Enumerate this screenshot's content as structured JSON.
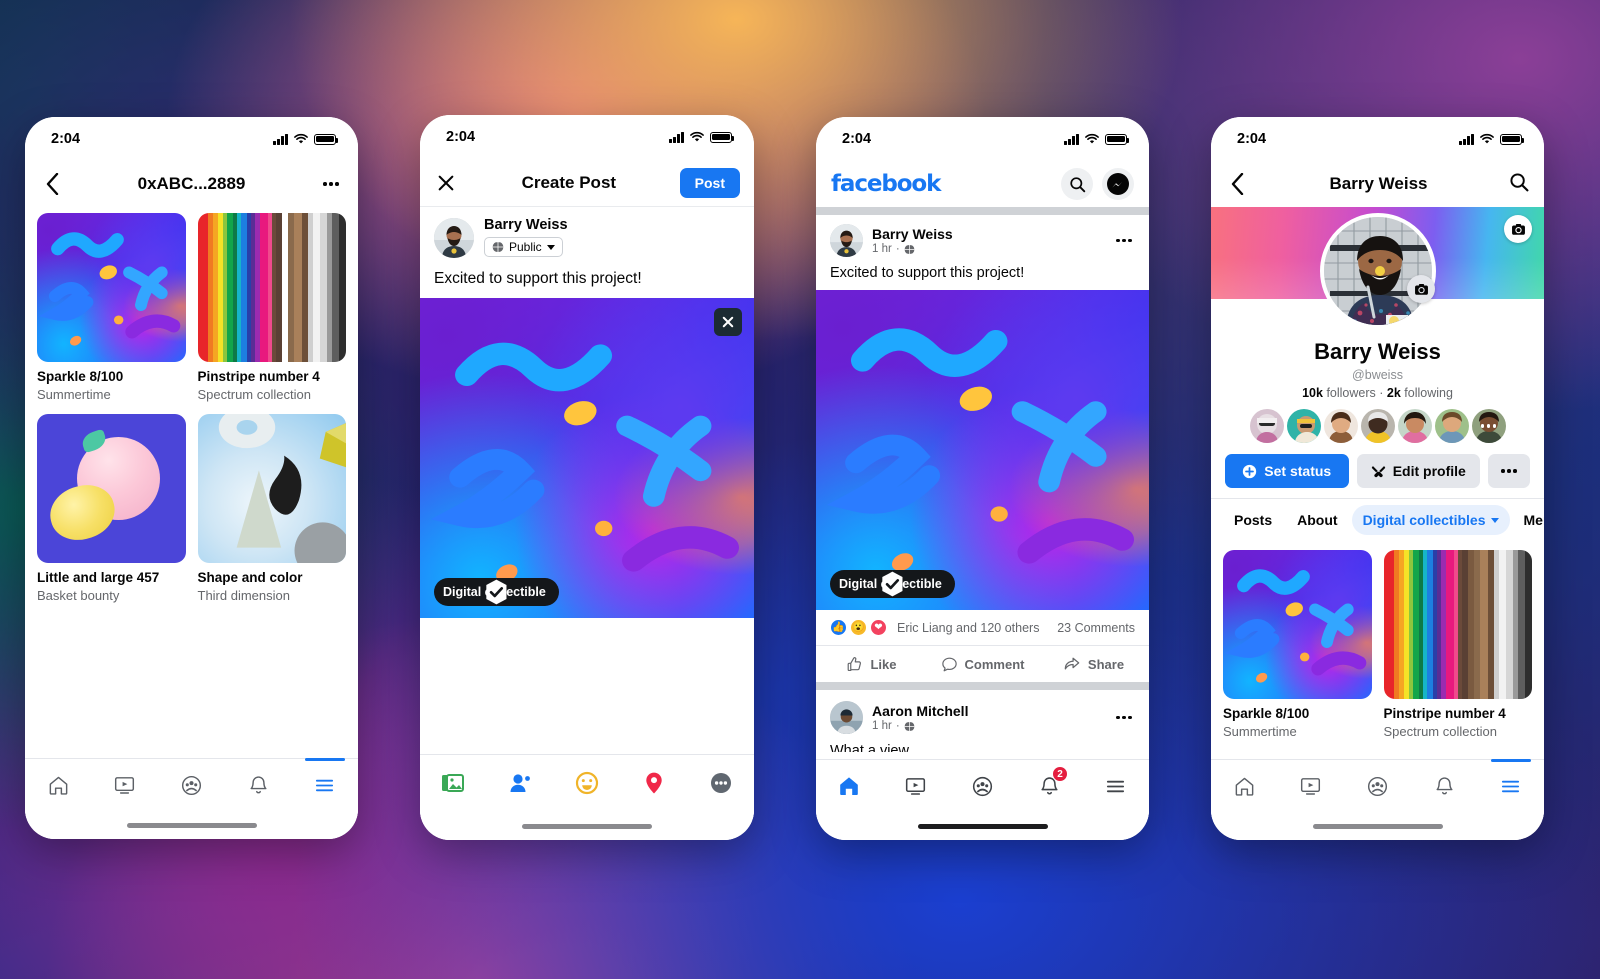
{
  "background": {
    "style": "colorful-mesh-gradient"
  },
  "phones": {
    "collection": {
      "status": {
        "time": "2:04",
        "signal_icon": "cellular-bars-icon",
        "wifi_icon": "wifi-icon",
        "battery_icon": "battery-icon"
      },
      "header": {
        "back_icon": "chevron-left-icon",
        "title": "0xABC...2889",
        "more_icon": "more-horizontal-icon"
      },
      "items": [
        {
          "name": "Sparkle 8/100",
          "collection": "Summertime",
          "art": "sparkle"
        },
        {
          "name": "Pinstripe number 4",
          "collection": "Spectrum collection",
          "art": "pinstripe"
        },
        {
          "name": "Little and large 457",
          "collection": "Basket bounty",
          "art": "fruit"
        },
        {
          "name": "Shape and color",
          "collection": "Third dimension",
          "art": "shapes"
        }
      ],
      "tabbar": {
        "active": "menu",
        "items": [
          {
            "name": "home-icon",
            "label": "Home"
          },
          {
            "name": "video-icon",
            "label": "Watch"
          },
          {
            "name": "groups-icon",
            "label": "Groups"
          },
          {
            "name": "bell-icon",
            "label": "Notifications"
          },
          {
            "name": "menu-icon",
            "label": "Menu"
          }
        ]
      }
    },
    "create_post": {
      "status": {
        "time": "2:04"
      },
      "header": {
        "close_icon": "close-icon",
        "title": "Create Post",
        "post_label": "Post"
      },
      "author": {
        "name": "Barry Weiss",
        "audience": "Public",
        "audience_icon": "globe-icon",
        "caret_icon": "chevron-down-icon"
      },
      "composer_text": "Excited to support this project!",
      "attachment": {
        "remove_icon": "close-icon",
        "badge_label": "Digital collectible",
        "badge_icon": "verified-hexagon-icon"
      },
      "tray": [
        {
          "name": "photo-icon",
          "label": "Photo/Video",
          "color": "#45bd62"
        },
        {
          "name": "tag-people-icon",
          "label": "Tag People",
          "color": "#1877f2"
        },
        {
          "name": "feeling-icon",
          "label": "Feeling/Activity",
          "color": "#f7b928"
        },
        {
          "name": "location-icon",
          "label": "Check in",
          "color": "#f02849"
        },
        {
          "name": "more-icon",
          "label": "More",
          "color": "#606770"
        }
      ]
    },
    "feed": {
      "status": {
        "time": "2:04"
      },
      "header": {
        "logo": "facebook",
        "search_icon": "search-icon",
        "messenger_icon": "messenger-icon"
      },
      "post": {
        "author": "Barry Weiss",
        "time": "1 hr",
        "audience_icon": "globe-icon",
        "more_icon": "more-horizontal-icon",
        "text": "Excited to support this project!",
        "badge_label": "Digital collectible",
        "badge_icon": "verified-hexagon-icon",
        "reactions_text": "Eric Liang and 120 others",
        "reactions": [
          "like-icon",
          "wow-icon",
          "love-icon"
        ],
        "comments_text": "23 Comments",
        "actions": [
          {
            "name": "like-button",
            "label": "Like",
            "icon": "thumbs-up-icon"
          },
          {
            "name": "comment-button",
            "label": "Comment",
            "icon": "comment-bubble-icon"
          },
          {
            "name": "share-button",
            "label": "Share",
            "icon": "share-arrow-icon"
          }
        ]
      },
      "next_post": {
        "author": "Aaron Mitchell",
        "time": "1 hr",
        "text": "What a view",
        "more_icon": "more-horizontal-icon"
      },
      "tabbar": {
        "active": "home",
        "notification_badge": "2",
        "items": [
          {
            "name": "home-icon",
            "label": "Home"
          },
          {
            "name": "video-icon",
            "label": "Watch"
          },
          {
            "name": "groups-icon",
            "label": "Groups"
          },
          {
            "name": "bell-icon",
            "label": "Notifications"
          },
          {
            "name": "menu-icon",
            "label": "Menu"
          }
        ]
      }
    },
    "profile": {
      "status": {
        "time": "2:04"
      },
      "header": {
        "back_icon": "chevron-left-icon",
        "title": "Barry Weiss",
        "search_icon": "search-icon"
      },
      "cover_camera_icon": "camera-icon",
      "avatar_camera_icon": "camera-icon",
      "name": "Barry Weiss",
      "handle": "@bweiss",
      "followers_count": "10k",
      "followers_label": "followers",
      "following_count": "2k",
      "following_label": "following",
      "friends_overflow": "more-horizontal-icon",
      "buttons": {
        "set_status": "Set status",
        "set_status_icon": "plus-circle-icon",
        "edit_profile": "Edit profile",
        "edit_profile_icon": "tools-icon",
        "more_icon": "more-horizontal-icon"
      },
      "tabs": [
        {
          "label": "Posts",
          "active": false
        },
        {
          "label": "About",
          "active": false
        },
        {
          "label": "Digital collectibles",
          "active": true,
          "caret_icon": "chevron-down-icon"
        },
        {
          "label": "Mentions",
          "active": false
        }
      ],
      "items": [
        {
          "name": "Sparkle 8/100",
          "collection": "Summertime",
          "art": "sparkle"
        },
        {
          "name": "Pinstripe number 4",
          "collection": "Spectrum collection",
          "art": "pinstripe"
        }
      ],
      "tabbar": {
        "active": "menu",
        "items": [
          {
            "name": "home-icon",
            "label": "Home"
          },
          {
            "name": "video-icon",
            "label": "Watch"
          },
          {
            "name": "groups-icon",
            "label": "Groups"
          },
          {
            "name": "bell-icon",
            "label": "Notifications"
          },
          {
            "name": "menu-icon",
            "label": "Menu"
          }
        ]
      }
    }
  },
  "colors": {
    "brand_blue": "#1877f2",
    "badge_dark": "#14171a",
    "red": "#e41e3f",
    "grey_text": "#65676b"
  }
}
